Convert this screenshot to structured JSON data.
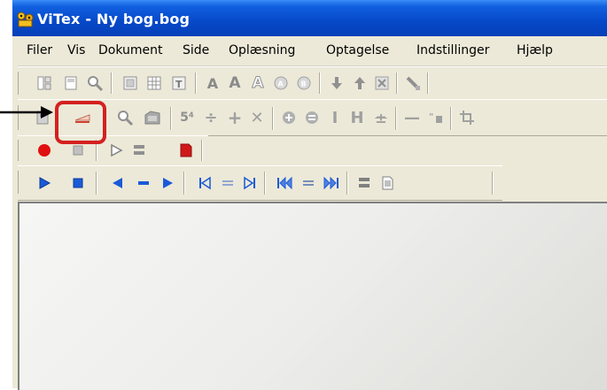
{
  "window": {
    "title": "ViTex - Ny bog.bog"
  },
  "menu": {
    "items": [
      "Filer",
      "Vis",
      "Dokument",
      "Side",
      "Oplæsning",
      "Optagelse",
      "Indstillinger",
      "Hjælp"
    ]
  },
  "colors": {
    "titlebar": "#0648c8",
    "highlight": "#d42020",
    "record": "#e01010"
  },
  "toolbar1": {
    "icons": [
      "layout-icon",
      "page-icon",
      "search-icon",
      "grid-single-icon",
      "grid-icon",
      "text-frame-icon",
      "font-a-icon",
      "font-a-large-icon",
      "font-a-outline-icon",
      "circle-a-icon",
      "circle-b-icon",
      "arrow-down-icon",
      "arrow-up-icon",
      "close-box-icon",
      "pen-icon"
    ]
  },
  "toolbar2": {
    "icons": [
      "bookmark-icon",
      "underline-tool-icon",
      "magnify-icon",
      "folder-icon",
      "superscript-icon",
      "divide-icon",
      "plus-icon",
      "multiply-icon",
      "circle-plus-icon",
      "circle-minus-icon",
      "text-cursor-icon",
      "h-bracket-icon",
      "strike-icon",
      "minus-icon",
      "quote-icon",
      "crop-icon"
    ],
    "superscript_label": "5⁴"
  },
  "toolbar3": {
    "icons": [
      "record-icon",
      "stop-icon",
      "play-outline-icon",
      "lines-icon",
      "red-page-icon"
    ]
  },
  "toolbar4": {
    "icons": [
      "play-icon",
      "stop-icon",
      "prev-icon",
      "dash-icon",
      "next-icon",
      "skip-start-icon",
      "lines-small-icon",
      "skip-end-icon",
      "fast-back-icon",
      "lines-dark-icon",
      "fast-forward-icon",
      "doc-lines-icon",
      "document-icon"
    ]
  }
}
